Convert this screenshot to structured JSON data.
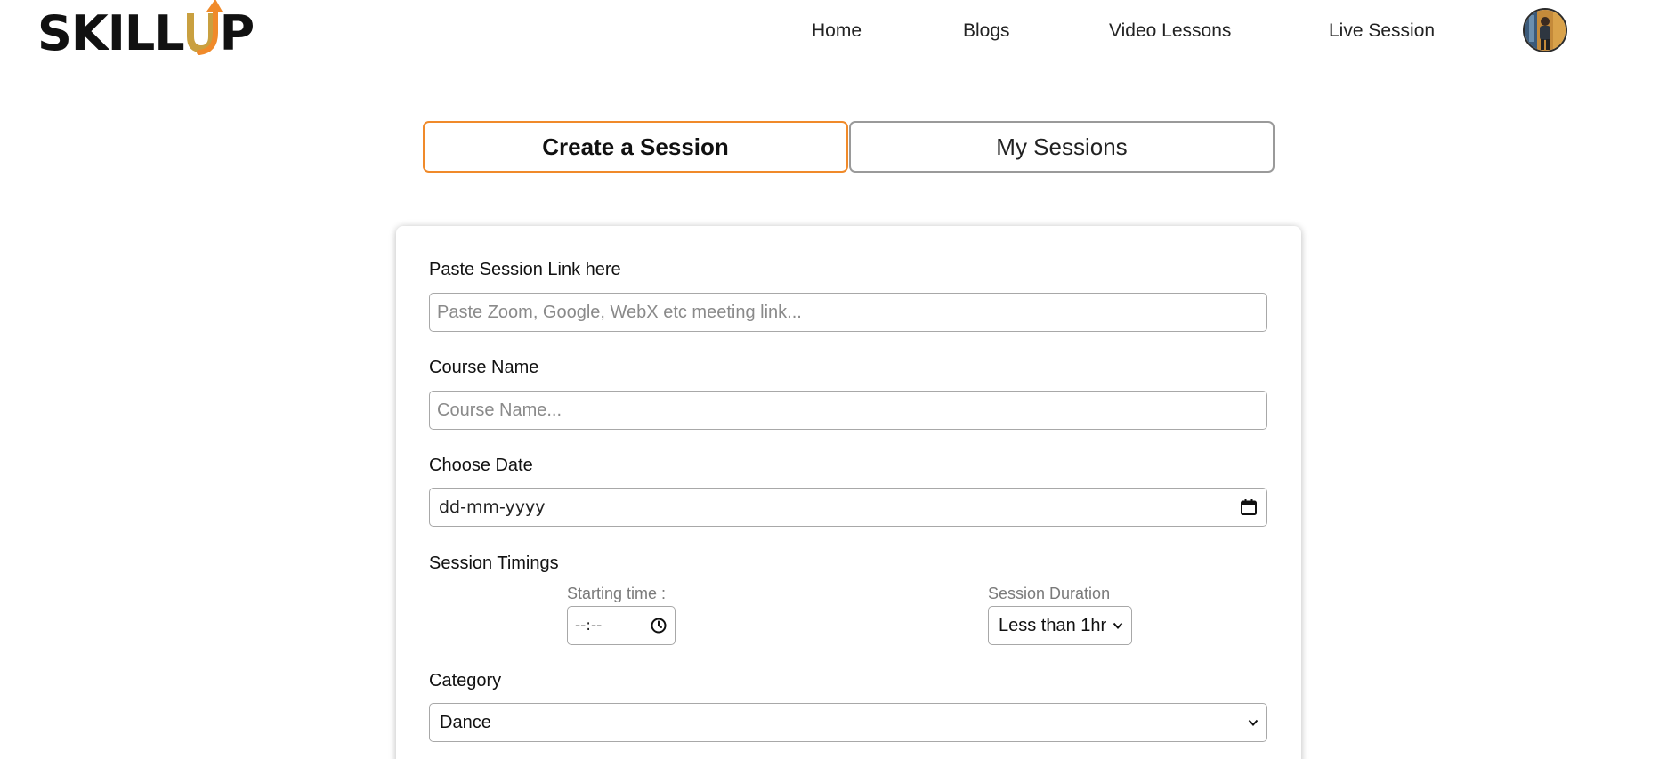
{
  "brand": {
    "logo_text_left": "SKILL",
    "logo_letter_u": "U",
    "logo_text_right": "P",
    "accent_color": "#f08a2a",
    "logo_u_color": "#c9a040"
  },
  "nav": {
    "home": "Home",
    "blogs": "Blogs",
    "video_lessons": "Video Lessons",
    "live_session": "Live Session",
    "avatar_icon": "user-avatar"
  },
  "tabs": {
    "create": "Create a Session",
    "my_sessions": "My Sessions",
    "active": "create"
  },
  "form": {
    "session_link": {
      "label": "Paste Session Link here",
      "placeholder": "Paste Zoom, Google, WebX etc meeting link...",
      "value": ""
    },
    "course_name": {
      "label": "Course Name",
      "placeholder": "Course Name...",
      "value": ""
    },
    "date": {
      "label": "Choose Date",
      "value": "dd-mm-yyyy",
      "icon": "calendar-icon"
    },
    "timings": {
      "label": "Session Timings",
      "start_label": "Starting time :",
      "start_value": "--:--",
      "start_icon": "clock-icon",
      "duration_label": "Session Duration",
      "duration_value": "Less than 1hr"
    },
    "category": {
      "label": "Category",
      "value": "Dance"
    }
  },
  "colors": {
    "active_tab_border": "#f08a2a",
    "inactive_tab_border": "#9a9a9a",
    "input_border": "#a8a8a8",
    "placeholder": "#8a8a8a",
    "sub_label": "#7a7a7a"
  }
}
